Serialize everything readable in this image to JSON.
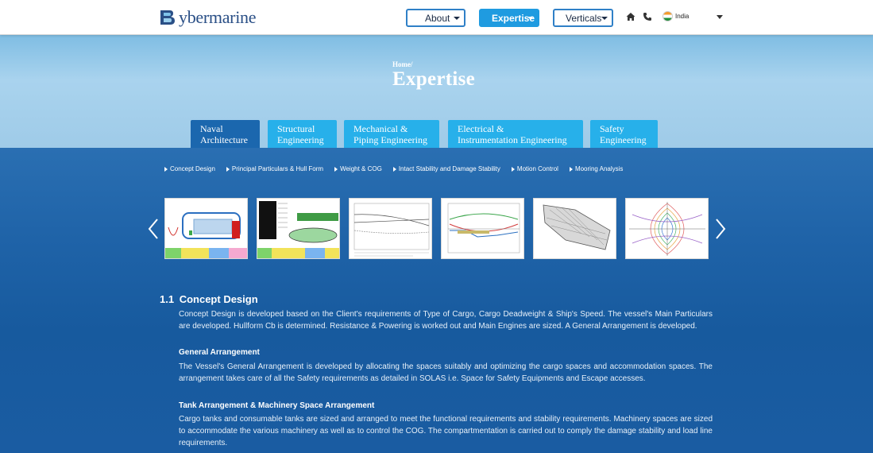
{
  "header": {
    "logo_text": "ybermarine",
    "nav": [
      {
        "label": "About"
      },
      {
        "label": "Expertise"
      },
      {
        "label": "Verticals"
      }
    ],
    "country": "India"
  },
  "hero": {
    "breadcrumb": "Home/",
    "title": "Expertise"
  },
  "tabs": [
    {
      "line1": "Naval",
      "line2": "Architecture"
    },
    {
      "line1": "Structural",
      "line2": "Engineering"
    },
    {
      "line1": "Mechanical &",
      "line2": "Piping Engineering"
    },
    {
      "line1": "Electrical &",
      "line2": "Instrumentation Engineering"
    },
    {
      "line1": "Safety",
      "line2": "Engineering"
    }
  ],
  "sublinks": [
    "Concept Design",
    "Principal Particulars & Hull Form",
    "Weight & COG",
    "Intact Stability and Damage Stability",
    "Motion Control",
    "Mooring Analysis"
  ],
  "carousel": {
    "thumbnails": [
      "general-arrangement-plan",
      "hull-form-table",
      "resistance-curves",
      "stability-curves",
      "hull-3d-model",
      "polar-diagram"
    ]
  },
  "content": {
    "section_number": "1.1",
    "section_title": "Concept Design",
    "intro": "Concept Design is developed based on the Client's requirements of Type of Cargo, Cargo Deadweight & Ship's Speed. The vessel's Main Particulars are developed. Hullform Cb is determined. Resistance & Powering is worked out and Main Engines are sized. A General Arrangement is developed.",
    "blocks": [
      {
        "heading": "General Arrangement",
        "text": "The Vessel's General Arrangement is developed by allocating the spaces suitably and optimizing the cargo spaces and accommodation spaces. The arrangement takes care of all the Safety requirements as detailed in SOLAS i.e. Space for Safety Equipments and Escape accesses."
      },
      {
        "heading": "Tank Arrangement & Machinery Space Arrangement",
        "text": "Cargo tanks and consumable tanks are sized and arranged to meet the functional requirements and stability requirements. Machinery spaces are sized to accommodate the various machinery as well as to control the COG. The compartmentation is carried out to comply the damage stability and load line requirements."
      }
    ]
  },
  "colors": {
    "accent": "#27b0ea",
    "active_tab": "#1b67ae",
    "brand": "#2a4f86"
  }
}
